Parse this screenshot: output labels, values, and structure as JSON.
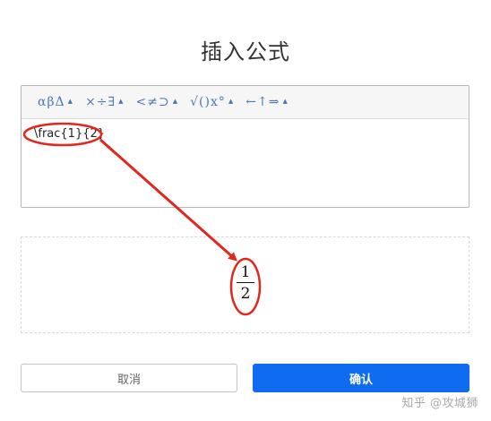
{
  "dialog": {
    "title": "插入公式"
  },
  "toolbar": {
    "groups": [
      {
        "glyphs": "αβΔ"
      },
      {
        "glyphs": "×÷∃"
      },
      {
        "glyphs": "<≠⊃"
      },
      {
        "glyphs": "√()x°"
      },
      {
        "glyphs": "←↑⇒"
      }
    ]
  },
  "editor": {
    "value": "\\frac{1}{2}"
  },
  "preview": {
    "numerator": "1",
    "denominator": "2"
  },
  "buttons": {
    "cancel_label": "取消",
    "confirm_label": "确认"
  },
  "colors": {
    "primary": "#0f6bf0",
    "annotation": "#e0281f",
    "toolbar_glyph": "#4a76b8"
  },
  "watermark": {
    "text": "知乎 @攻城狮"
  }
}
